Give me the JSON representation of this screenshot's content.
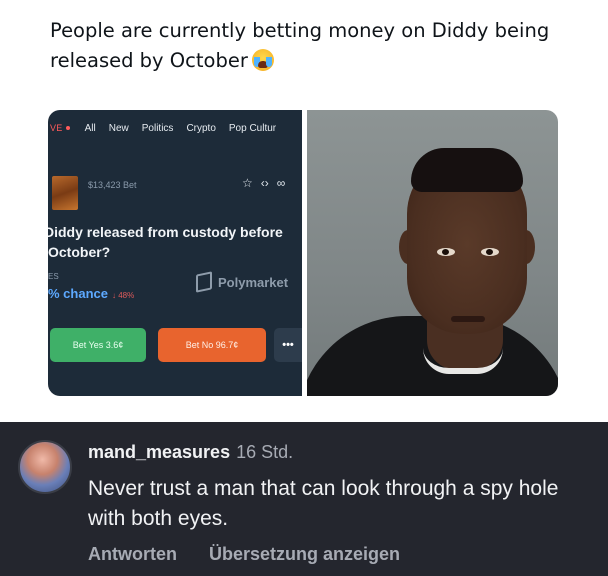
{
  "tweet": {
    "text": "People are currently betting money on Diddy being released by October",
    "emoji": "crying-face-emoji"
  },
  "polymarket": {
    "nav": {
      "live": "VE",
      "items": [
        "All",
        "New",
        "Politics",
        "Crypto",
        "Pop Cultur"
      ]
    },
    "bet_volume": "$13,423 Bet",
    "icons": [
      "star-icon",
      "embed-icon",
      "link-icon"
    ],
    "question": "Diddy released from custody before October?",
    "outcome_label": "ES",
    "chance": "% chance",
    "chance_change": "↓ 48%",
    "brand": "Polymarket",
    "buttons": {
      "yes": "Bet Yes 3.6¢",
      "no": "Bet No 96.7¢",
      "more": "•••"
    }
  },
  "comment": {
    "username": "mand_measures",
    "time": "16 Std.",
    "body": "Never trust a man that can look through a spy hole with both eyes.",
    "actions": {
      "reply": "Antworten",
      "translate": "Übersetzung anzeigen"
    }
  }
}
